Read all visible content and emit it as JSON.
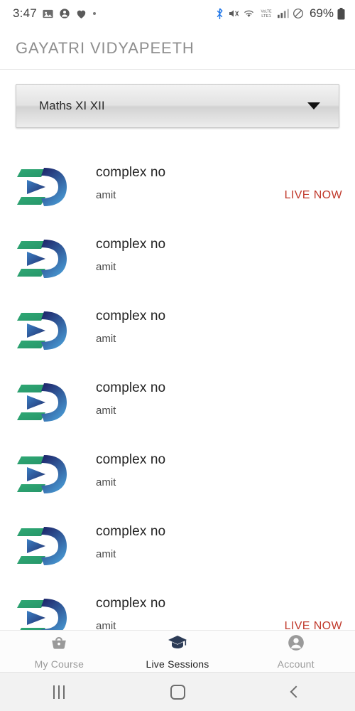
{
  "status_bar": {
    "time": "3:47",
    "battery_percent": "69%",
    "network_label": "LTE1",
    "volte_label": "VoLTE",
    "left_icons": [
      "image-icon",
      "contact-icon",
      "heart-icon",
      "dot-icon"
    ],
    "right_icons": [
      "bluetooth-icon",
      "mute-icon",
      "wifi-icon",
      "volte-icon",
      "signal-icon",
      "do-not-disturb-icon",
      "battery-icon"
    ]
  },
  "header": {
    "title": "GAYATRI VIDYAPEETH"
  },
  "course_selector": {
    "selected": "Maths XI XII",
    "icon": "chevron-down-icon"
  },
  "sessions": {
    "items": [
      {
        "title": "complex no",
        "instructor": "amit",
        "status": "LIVE NOW"
      },
      {
        "title": "complex no",
        "instructor": "amit",
        "status": ""
      },
      {
        "title": "complex no",
        "instructor": "amit",
        "status": ""
      },
      {
        "title": "complex no",
        "instructor": "amit",
        "status": ""
      },
      {
        "title": "complex no",
        "instructor": "amit",
        "status": ""
      },
      {
        "title": "complex no",
        "instructor": "amit",
        "status": ""
      },
      {
        "title": "complex no",
        "instructor": "amit",
        "status": "LIVE NOW"
      }
    ]
  },
  "bottom_nav": {
    "tabs": [
      {
        "label": "My Course",
        "icon": "basket-icon",
        "active": false
      },
      {
        "label": "Live Sessions",
        "icon": "graduation-cap-icon",
        "active": true
      },
      {
        "label": "Account",
        "icon": "account-circle-icon",
        "active": false
      }
    ]
  },
  "system_nav": {
    "recents": "recents-icon",
    "home": "home-icon",
    "back": "back-icon"
  },
  "colors": {
    "live_now": "#c0392b",
    "title_gray": "#8e8e8e",
    "active_tab": "#1f1f1f",
    "inactive_tab": "#9a9a9a",
    "logo_green": "#2fa874",
    "logo_navy": "#1f2a6e",
    "logo_blue": "#4a9fd8"
  }
}
